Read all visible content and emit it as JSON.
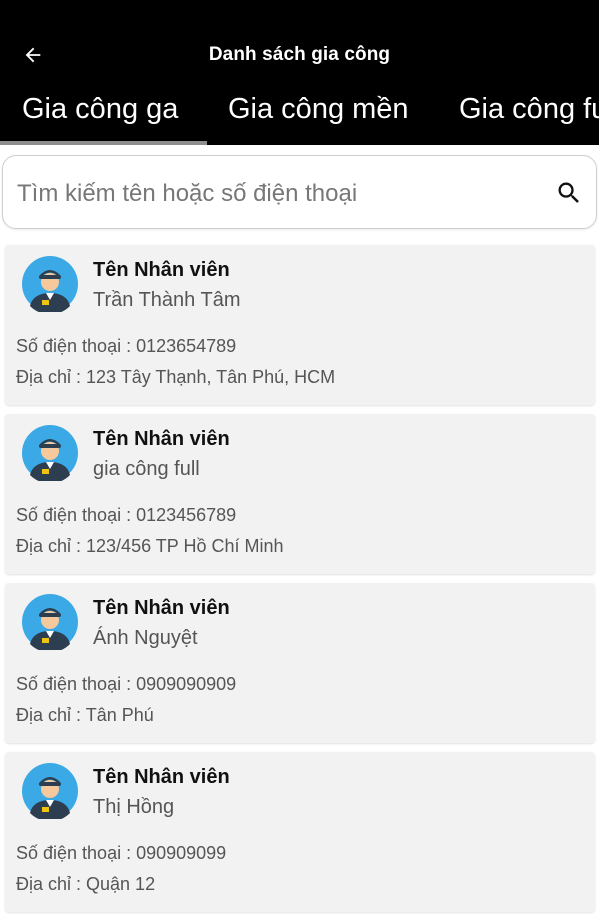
{
  "header": {
    "title": "Danh sách gia công"
  },
  "tabs": [
    {
      "label": "Gia công ga"
    },
    {
      "label": "Gia công mền"
    },
    {
      "label": "Gia công full"
    }
  ],
  "search": {
    "placeholder": "Tìm kiếm tên hoặc số điện thoại",
    "value": ""
  },
  "employees": [
    {
      "label": "Tên Nhân viên",
      "name": "Trần Thành Tâm",
      "phone": "Số điện thoại : 0123654789",
      "address": "Địa chỉ : 123 Tây Thạnh, Tân Phú, HCM"
    },
    {
      "label": "Tên Nhân viên",
      "name": "gia công full",
      "phone": "Số điện thoại : 0123456789",
      "address": "Địa chỉ : 123/456 TP Hồ Chí Minh"
    },
    {
      "label": "Tên Nhân viên",
      "name": "Ánh Nguyệt",
      "phone": "Số điện thoại : 0909090909",
      "address": "Địa chỉ : Tân Phú"
    },
    {
      "label": "Tên Nhân viên",
      "name": "Thị Hồng",
      "phone": "Số điện thoại : 090909099",
      "address": "Địa chỉ : Quận 12"
    }
  ],
  "colors": {
    "appbar": "#000000",
    "tab_indicator": "#8e8e8e",
    "card_background": "#f2f2f2",
    "avatar_background": "#3aa9e6"
  },
  "icons": {
    "back": "arrow-left-icon",
    "search": "search-icon",
    "avatar": "employee-avatar-icon"
  }
}
